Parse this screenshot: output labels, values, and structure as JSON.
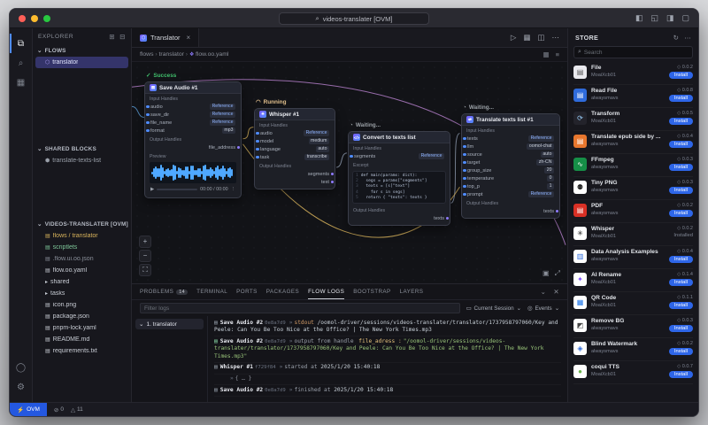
{
  "title_bar": {
    "title": "videos-translater [OVM]"
  },
  "activity_bar": {
    "top": [
      {
        "name": "explorer-icon",
        "glyph": "⧉"
      },
      {
        "name": "search-icon",
        "glyph": "⌕"
      },
      {
        "name": "store-box-icon",
        "glyph": "▦"
      }
    ],
    "bottom": [
      {
        "name": "account-icon",
        "glyph": "◯"
      },
      {
        "name": "settings-gear-icon",
        "glyph": "⚙"
      }
    ]
  },
  "explorer": {
    "header": "EXPLORER",
    "header_icons": [
      {
        "name": "new-file-icon",
        "glyph": "⊞"
      },
      {
        "name": "collapse-all-icon",
        "glyph": "⊟"
      }
    ],
    "sections": [
      {
        "label": "FLOWS",
        "items": [
          {
            "label": "translator",
            "selected": true,
            "glyph": "⬡",
            "color": "#b9a7ff"
          }
        ]
      },
      {
        "label": "SHARED BLOCKS",
        "items": [
          {
            "label": "translate-texts-list",
            "glyph": "⬢",
            "color": "#9aa0aa"
          }
        ]
      },
      {
        "label": "VIDEOS-TRANSLATER [OVM]",
        "items": [
          {
            "label": "flows / translator",
            "glyph": "▤",
            "color": "#d8b35c"
          },
          {
            "label": "scriptlets",
            "glyph": "▤",
            "color": "#7ec699"
          },
          {
            "label": ".flow.ui.oo.json",
            "glyph": "▤",
            "color": "#8a8f99"
          },
          {
            "label": "flow.oo.yaml",
            "glyph": "▤",
            "color": "#c8ccd4"
          },
          {
            "label": "shared",
            "glyph": "▸",
            "color": "#c8ccd4"
          },
          {
            "label": "tasks",
            "glyph": "▸",
            "color": "#c8ccd4"
          },
          {
            "label": "icon.png",
            "glyph": "▤",
            "color": "#c8ccd4"
          },
          {
            "label": "package.json",
            "glyph": "▤",
            "color": "#c8ccd4"
          },
          {
            "label": "pnpm-lock.yaml",
            "glyph": "▤",
            "color": "#c8ccd4"
          },
          {
            "label": "README.md",
            "glyph": "▤",
            "color": "#c8ccd4"
          },
          {
            "label": "requirements.txt",
            "glyph": "▤",
            "color": "#c8ccd4"
          }
        ]
      }
    ]
  },
  "editor": {
    "tab_label": "Translator",
    "breadcrumb": [
      "flows",
      "translator",
      "flow.oo.yaml"
    ],
    "tab_actions": [
      {
        "name": "run-flow-icon",
        "glyph": "▷"
      },
      {
        "name": "layout-grid-icon",
        "glyph": "▦"
      },
      {
        "name": "split-editor-icon",
        "glyph": "◫"
      },
      {
        "name": "more-actions-icon",
        "glyph": "⋯"
      }
    ],
    "breadcrumb_actions": [
      {
        "name": "minimap-toggle-icon",
        "glyph": "▦"
      },
      {
        "name": "outline-icon",
        "glyph": "≡"
      }
    ]
  },
  "canvas": {
    "nodes": [
      {
        "id": "save-audio-1",
        "title": "Save Audio #1",
        "icon_glyph": "▤",
        "status": {
          "label": "Success",
          "kind": "success",
          "icon": "✓"
        },
        "sections": [
          {
            "title": "Input Handles",
            "rows": [
              {
                "label": "audio",
                "value": "Reference",
                "dir": "in"
              },
              {
                "label": "save_dir",
                "value": "Reference",
                "dir": "in"
              },
              {
                "label": "file_name",
                "value": "Reference",
                "dir": "in"
              },
              {
                "label": "format",
                "value": "mp3",
                "dir": "in"
              }
            ]
          },
          {
            "title": "Output Handles",
            "rows": [
              {
                "label": "file_address",
                "dir": "out"
              }
            ]
          },
          {
            "title": "Preview",
            "waveform": true,
            "player": {
              "time": "00:00 / 00:00"
            }
          }
        ]
      },
      {
        "id": "whisper-1",
        "title": "Whisper #1",
        "icon_glyph": "✳",
        "status": {
          "label": "Running",
          "kind": "running",
          "icon": "◠"
        },
        "sections": [
          {
            "title": "Input Handles",
            "rows": [
              {
                "label": "audio",
                "value": "Reference",
                "dir": "in"
              },
              {
                "label": "model",
                "value": "medium",
                "dir": "in"
              },
              {
                "label": "language",
                "value": "auto",
                "dir": "in"
              },
              {
                "label": "task",
                "value": "transcribe",
                "dir": "in"
              }
            ]
          },
          {
            "title": "Output Handles",
            "rows": [
              {
                "label": "segments",
                "dir": "out"
              },
              {
                "label": "text",
                "dir": "out"
              }
            ]
          }
        ]
      },
      {
        "id": "convert-to-texts-list",
        "title": "Convert to texts list",
        "icon_glyph": "</>",
        "status": {
          "label": "Waiting...",
          "kind": "waiting",
          "icon": "◔"
        },
        "sections": [
          {
            "title": "Input Handles",
            "rows": [
              {
                "label": "segments",
                "value": "Reference",
                "dir": "in"
              }
            ]
          },
          {
            "title": "Excerpt",
            "code": [
              "def main(params: dict):",
              "  segs = params[\"segments\"]",
              "  texts = [s[\"text\"]",
              "    for s in segs]",
              "  return { \"texts\": texts }"
            ]
          },
          {
            "title": "Output Handles",
            "rows": [
              {
                "label": "texts",
                "dir": "out"
              }
            ]
          }
        ]
      },
      {
        "id": "translate-texts-list-1",
        "title": "Translate texts list #1",
        "icon_glyph": "⇄",
        "status": {
          "label": "Waiting...",
          "kind": "waiting",
          "icon": "◔"
        },
        "sections": [
          {
            "title": "Input Handles",
            "rows": [
              {
                "label": "texts",
                "value": "Reference",
                "dir": "in"
              },
              {
                "label": "llm",
                "value": "oomol-chat",
                "dir": "in"
              },
              {
                "label": "source",
                "value": "auto",
                "dir": "in"
              },
              {
                "label": "target",
                "value": "zh-CN",
                "dir": "in"
              },
              {
                "label": "group_size",
                "value": "20",
                "dir": "in"
              },
              {
                "label": "temperature",
                "value": "0",
                "dir": "in"
              },
              {
                "label": "top_p",
                "value": "1",
                "dir": "in"
              },
              {
                "label": "prompt",
                "value": "Reference",
                "dir": "in"
              }
            ]
          },
          {
            "title": "Output Handles",
            "rows": [
              {
                "label": "texts",
                "dir": "out"
              }
            ]
          }
        ]
      }
    ],
    "zoom_controls": [
      {
        "name": "zoom-in-button",
        "glyph": "+"
      },
      {
        "name": "zoom-out-button",
        "glyph": "−"
      },
      {
        "name": "zoom-fit-button",
        "glyph": "⛶"
      }
    ],
    "corner_tools": [
      {
        "name": "minimap-icon",
        "glyph": "▣"
      },
      {
        "name": "fullscreen-icon",
        "glyph": "⤢"
      }
    ]
  },
  "bottom_panel": {
    "tabs": [
      {
        "label": "PROBLEMS",
        "badge": "14"
      },
      {
        "label": "TERMINAL"
      },
      {
        "label": "PORTS"
      },
      {
        "label": "PACKAGES"
      },
      {
        "label": "FLOW LOGS",
        "active": true
      },
      {
        "label": "BOOTSTRAP"
      },
      {
        "label": "LAYERS"
      }
    ],
    "panel_actions": [
      {
        "name": "panel-chevron-down-icon",
        "glyph": "⌄"
      },
      {
        "name": "panel-close-icon",
        "glyph": "✕"
      }
    ],
    "filter_placeholder": "Filter logs",
    "session_select": "Current Session",
    "events_select": "Events",
    "tree_item": "1. translator",
    "logs": [
      {
        "icon": "▤",
        "icon_color": "#8b949e",
        "node": "Save Audio #2",
        "hash": "0e8a7d9",
        "arrow": "»",
        "channel": "stdout",
        "channel_color": "#d19a66",
        "text": "/oomol-driver/sessions/videos-translater/translator/1737958797060/Key and Peele:  Can You Be Too Nice at the Office?  |  The New York Times.mp3",
        "text_color": "#c9d1d9"
      },
      {
        "icon": "▤",
        "icon_color": "#7ec699",
        "node": "Save Audio #2",
        "hash": "0e8a7d9",
        "arrow": "»",
        "channel": "output from handle",
        "handle": "file_adress :",
        "channel_color": "#9aa0aa",
        "text": "\"/oomol-driver/sessions/videos-translater/translator/1737958797060/Key and Peele:  Can You Be Too Nice at the Office?  |  The New York Times.mp3\"",
        "text_color": "#98c379"
      },
      {
        "icon": "▤",
        "icon_color": "#8b949e",
        "node": "Whisper #1",
        "hash": "f729f84",
        "arrow": "»",
        "channel": "started at",
        "channel_color": "#9aa0aa",
        "text": "2025/1/20 15:40:18",
        "text_color": "#c9d1d9"
      },
      {
        "expand": true,
        "arrow": "»",
        "text": "{ … }"
      },
      {
        "icon": "▤",
        "icon_color": "#8b949e",
        "node": "Save Audio #2",
        "hash": "0e8a7d9",
        "arrow": "»",
        "channel": "finished at",
        "channel_color": "#9aa0aa",
        "text": "2025/1/20 15:40:18",
        "text_color": "#c9d1d9"
      }
    ]
  },
  "store": {
    "title": "STORE",
    "header_icons": [
      {
        "name": "refresh-icon",
        "glyph": "↻"
      },
      {
        "name": "store-more-icon",
        "glyph": "⋯"
      }
    ],
    "search_placeholder": "Search",
    "version_glyph": "◇",
    "items": [
      {
        "name": "File",
        "publisher": "MoaiXcb01",
        "version": "0.0.2",
        "action": "Install",
        "icon": {
          "name": "file-icon",
          "glyph": "▤",
          "bg": "#e9e9ee",
          "color": "#555"
        }
      },
      {
        "name": "Read File",
        "publisher": "alwaysmavs",
        "version": "0.0.8",
        "action": "Install",
        "icon": {
          "name": "read-file-icon",
          "glyph": "▤",
          "bg": "#2f6bdb",
          "color": "#fff"
        }
      },
      {
        "name": "Transform",
        "publisher": "MoaiXcb01",
        "version": "0.0.5",
        "action": "Install",
        "icon": {
          "name": "transform-icon",
          "glyph": "⟳",
          "bg": "#23232b",
          "color": "#9ad1ff"
        }
      },
      {
        "name": "Translate epub side by ...",
        "publisher": "alwaysmavs",
        "version": "0.0.4",
        "action": "Install",
        "icon": {
          "name": "epub-book-icon",
          "glyph": "▤",
          "bg": "#e8772e",
          "color": "#fff"
        }
      },
      {
        "name": "FFmpeg",
        "publisher": "alwaysmavs",
        "version": "0.0.3",
        "action": "Install",
        "icon": {
          "name": "ffmpeg-icon",
          "glyph": "∿",
          "bg": "#168f47",
          "color": "#fff"
        }
      },
      {
        "name": "Tiny PNG",
        "publisher": "alwaysmavs",
        "version": "0.0.3",
        "action": "Install",
        "icon": {
          "name": "panda-icon",
          "glyph": "⚉",
          "bg": "#ffffff",
          "color": "#222"
        }
      },
      {
        "name": "PDF",
        "publisher": "alwaysmavs",
        "version": "0.0.2",
        "action": "Install",
        "icon": {
          "name": "pdf-icon",
          "glyph": "▤",
          "bg": "#d93025",
          "color": "#fff"
        }
      },
      {
        "name": "Whisper",
        "publisher": "MoaiXcb01",
        "version": "0.0.2",
        "action": "Installed",
        "icon": {
          "name": "openai-icon",
          "glyph": "✳",
          "bg": "#ffffff",
          "color": "#111"
        }
      },
      {
        "name": "Data Analysis Examples",
        "publisher": "alwaysmavs",
        "version": "0.0.4",
        "action": "Install",
        "icon": {
          "name": "chart-icon",
          "glyph": "▥",
          "bg": "#ffffff",
          "color": "#2f6bdb"
        }
      },
      {
        "name": "AI Rename",
        "publisher": "MoaiXcb01",
        "version": "0.1.4",
        "action": "Install",
        "icon": {
          "name": "sparkle-icon",
          "glyph": "✦",
          "bg": "#ffffff",
          "color": "#7c4dff"
        }
      },
      {
        "name": "QR Code",
        "publisher": "MoaiXcb01",
        "version": "0.1.1",
        "action": "Install",
        "icon": {
          "name": "qr-code-icon",
          "glyph": "▦",
          "bg": "#ffffff",
          "color": "#1a73e8"
        }
      },
      {
        "name": "Remove BG",
        "publisher": "alwaysmavs",
        "version": "0.0.3",
        "action": "Install",
        "icon": {
          "name": "remove-bg-icon",
          "glyph": "◩",
          "bg": "#ffffff",
          "color": "#444"
        }
      },
      {
        "name": "Blind Watermark",
        "publisher": "alwaysmavs",
        "version": "0.0.2",
        "action": "Install",
        "icon": {
          "name": "watermark-icon",
          "glyph": "◈",
          "bg": "#ffffff",
          "color": "#2f6bdb"
        }
      },
      {
        "name": "coqui TTS",
        "publisher": "MoaiXcb01",
        "version": "0.0.7",
        "action": "Install",
        "icon": {
          "name": "frog-icon",
          "glyph": "●",
          "bg": "#ffffff",
          "color": "#69b34c"
        }
      }
    ]
  },
  "status_bar": {
    "remote_label": "OVM",
    "errors": "0",
    "warnings": "11"
  },
  "colors": {
    "accent": "#2e66e8",
    "success": "#41c06d",
    "running": "#e2c08d",
    "waiting": "#9aa0a6",
    "wire_yellow": "#d8b35c",
    "wire_gray": "#9aa7bd",
    "wire_purple": "#b07cc6",
    "wire_blue": "#5b9bd5"
  }
}
